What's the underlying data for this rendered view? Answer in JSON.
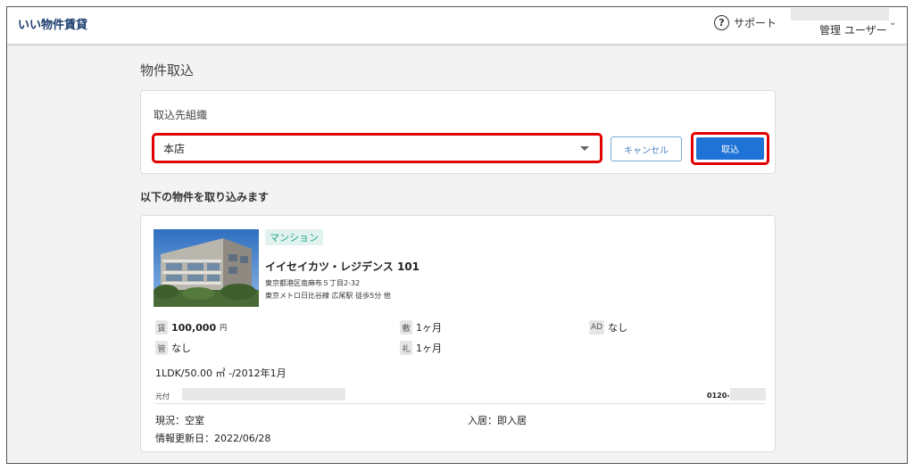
{
  "header": {
    "logo": "いい物件賃貸",
    "support_label": "サポート",
    "user_name": "管理 ユーザー"
  },
  "page": {
    "title": "物件取込"
  },
  "org": {
    "label": "取込先組織",
    "selected": "本店",
    "cancel_label": "キャンセル",
    "import_label": "取込"
  },
  "section": {
    "title": "以下の物件を取り込みます"
  },
  "property": {
    "tag": "マンション",
    "name": "イイセイカツ・レジデンス 101",
    "address": "東京都港区南麻布５丁目2-32",
    "access": "東京メトロ日比谷線 広尾駅 徒歩5分 他",
    "fees": {
      "rent_badge": "賃",
      "rent_value": "100,000",
      "rent_unit": "円",
      "mgmt_badge": "管",
      "mgmt_value": "なし",
      "deposit_badge": "敷",
      "deposit_value": "1ヶ月",
      "key_badge": "礼",
      "key_value": "1ヶ月",
      "ad_badge": "AD",
      "ad_value": "なし"
    },
    "layout_info": "1LDK/50.00 ㎡ -/2012年1月",
    "source_label": "元付",
    "phone_prefix": "0120-",
    "status": "現況：空室",
    "move_in": "入居：即入居",
    "updated": "情報更新日：2022/06/28"
  },
  "colors": {
    "accent_red": "#e00000",
    "primary_blue": "#1f73d6",
    "tag_green": "#1ba58a"
  }
}
